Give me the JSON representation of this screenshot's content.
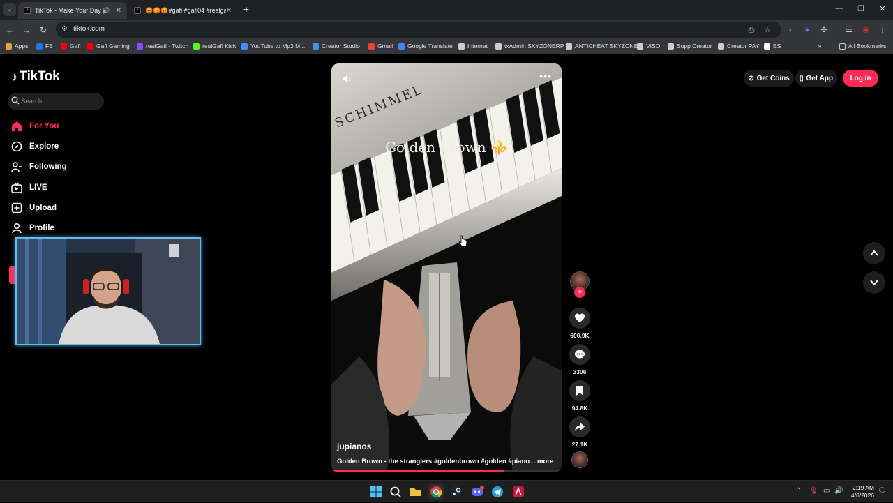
{
  "browser": {
    "tabs": [
      {
        "title": "TikTok - Make Your Day",
        "active": true
      },
      {
        "title": "😡😡😡#gafi #gafi04 #realgafi",
        "active": false
      }
    ],
    "url": "tiktok.com",
    "bookmarks": [
      {
        "label": "Apps",
        "color": "#e8a33d"
      },
      {
        "label": "FB",
        "color": "#1877f2"
      },
      {
        "label": "Gafi",
        "color": "#ff0000"
      },
      {
        "label": "Gafi Gaming",
        "color": "#ff0000"
      },
      {
        "label": "realGafi - Twitch",
        "color": "#9146ff"
      },
      {
        "label": "realGafi Kick",
        "color": "#53fc18"
      },
      {
        "label": "YouTube to Mp3 M...",
        "color": "#4a8cff"
      },
      {
        "label": "Creator Studio",
        "color": "#4a90e2"
      },
      {
        "label": "Gmail",
        "color": "#ea4335"
      },
      {
        "label": "Google Translate",
        "color": "#4285f4"
      },
      {
        "label": "Internet",
        "color": "#cccccc"
      },
      {
        "label": "txAdmin SKYZONERP",
        "color": "#cccccc"
      },
      {
        "label": "ANTICHEAT SKYZONE",
        "color": "#cccccc"
      },
      {
        "label": "VISO",
        "color": "#cccccc"
      },
      {
        "label": "Supp Creator",
        "color": "#cccccc"
      },
      {
        "label": "Creator PAY",
        "color": "#cccccc"
      },
      {
        "label": "ES",
        "color": "#ffffff"
      }
    ],
    "all_bookmarks": "All Bookmarks"
  },
  "tiktok": {
    "logo": "TikTok",
    "search_placeholder": "Search",
    "nav": [
      {
        "label": "For You",
        "icon": "home-icon",
        "active": true
      },
      {
        "label": "Explore",
        "icon": "compass-icon",
        "active": false
      },
      {
        "label": "Following",
        "icon": "following-icon",
        "active": false
      },
      {
        "label": "LIVE",
        "icon": "live-icon",
        "active": false
      },
      {
        "label": "Upload",
        "icon": "upload-icon",
        "active": false
      },
      {
        "label": "Profile",
        "icon": "profile-icon",
        "active": false
      }
    ],
    "get_coins": "Get Coins",
    "get_app": "Get App",
    "login": "Log in",
    "video": {
      "brand_text": "SCHIMMEL",
      "overlay_title": "Golden Brown ⚜️",
      "author": "jupianos",
      "caption": "Golden Brown - the stranglers #goldenbrown #golden #piano ...",
      "more": "more",
      "progress": 0.75
    },
    "actions": {
      "likes": "600.9K",
      "comments": "3306",
      "saves": "94.8K",
      "shares": "27.1K"
    }
  },
  "taskbar": {
    "time": "2:19 AM",
    "date": "4/6/2026"
  }
}
